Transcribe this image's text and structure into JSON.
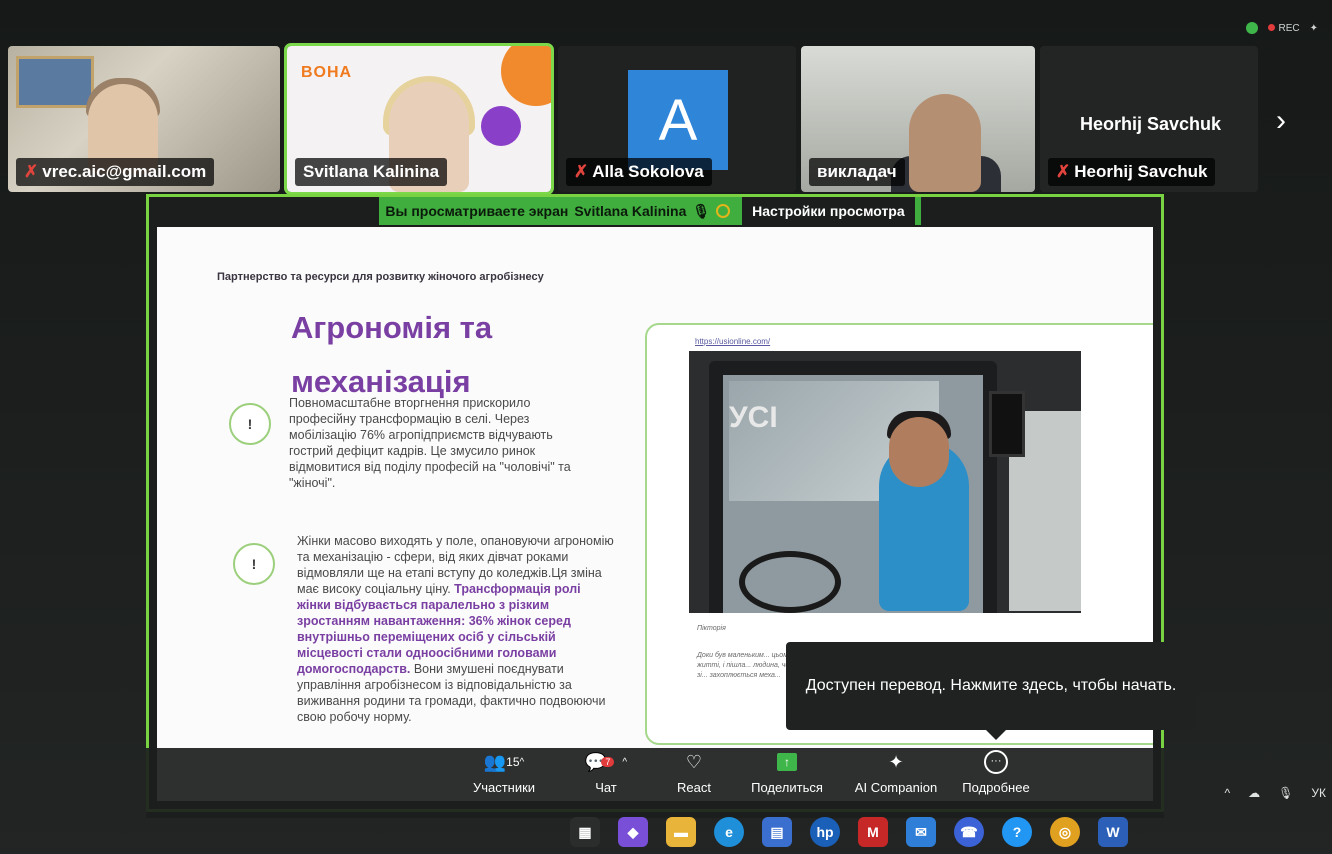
{
  "status": {
    "rec_label": "REC"
  },
  "gallery": {
    "participants": [
      {
        "name": "vrec.aic@gmail.com",
        "muted": true
      },
      {
        "name": "Svitlana Kalinina",
        "muted": false,
        "logo": "BOHA"
      },
      {
        "name": "Alla Sokolova",
        "muted": true,
        "avatar_letter": "A"
      },
      {
        "name": "викладач",
        "muted": false
      },
      {
        "name": "Heorhij Savchuk",
        "muted": true,
        "big_name": "Heorhij Savchuk"
      }
    ]
  },
  "share_banner": {
    "text": "Вы просматриваете экран",
    "presenter": "Svitlana Kalinina",
    "settings_label": "Настройки просмотра"
  },
  "slide": {
    "subtitle": "Партнерство та ресурси для розвитку жіночого агробізнесу",
    "title": "Агрономія та механізація",
    "bullet_marker": "!",
    "para1": "Повномасштабне вторгнення прискорило професійну трансформацію в селі. Через мобілізацію 76% агропідприємств відчувають гострий дефіцит кадрів. Це змусило ринок відмовитися від поділу професій на \"чоловічі\" та \"жіночі\".",
    "para2_start": "Жінки масово виходять у поле, опановуючи агрономію та механізацію - сфери, від яких дівчат роками відмовляли ще на етапі вступу до коледжів.Ця зміна має високу соціальну ціну. ",
    "para2_bold": "Трансформація ролі жінки відбувається паралельно з різким зростанням навантаження: 36% жінок серед внутрішньо переміщених осіб у сільській місцевості стали одноосібними головами домогосподарств.",
    "para2_end": " Вони змушені поєднувати управління агробізнесом із відповідальністю за виживання родини та громади, фактично подвоюючи свою робочу норму.",
    "link": "https://usionline.com/",
    "photo_logo": "УСІ",
    "caption_title": "Пікторія",
    "caption_body": "Доки був маленьким... цьому житті, і пішла... людина, чоловік зі... захоплюється меха..."
  },
  "tooltip": {
    "text": "Доступен перевод. Нажмите здесь, чтобы начать."
  },
  "toolbar": {
    "participants_count": "15",
    "participants_label": "Участники",
    "chat_label": "Чат",
    "chat_badge": "7",
    "react_label": "React",
    "share_label": "Поделиться",
    "ai_label": "AI Companion",
    "more_label": "Подробнее"
  },
  "taskbar": {
    "lang": "УК"
  }
}
